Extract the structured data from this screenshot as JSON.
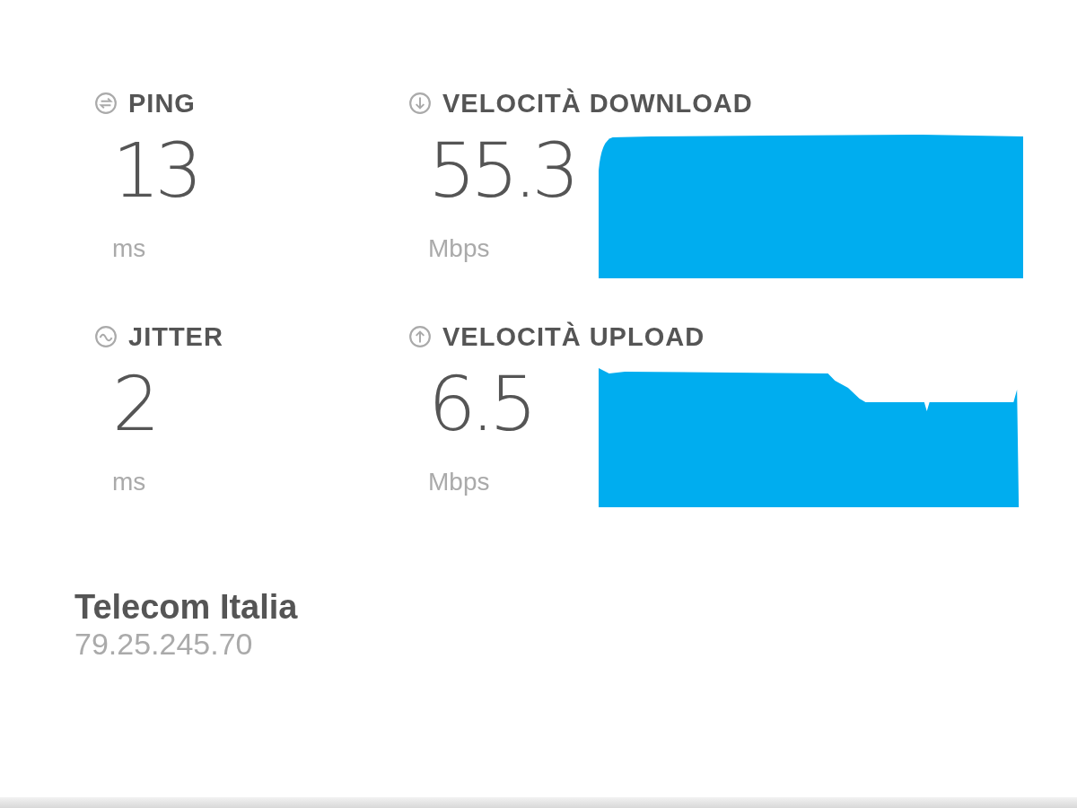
{
  "metrics": [
    {
      "kind": "ping",
      "label": "PING",
      "value": "13",
      "unit": "ms"
    },
    {
      "kind": "download",
      "label": "VELOCITÀ DOWNLOAD",
      "value": "55.3",
      "unit": "Mbps"
    },
    {
      "kind": "jitter",
      "label": "JITTER",
      "value": "2",
      "unit": "ms"
    },
    {
      "kind": "upload",
      "label": "VELOCITÀ UPLOAD",
      "value": "6.5",
      "unit": "Mbps"
    }
  ],
  "provider": {
    "name": "Telecom Italia",
    "ip": "79.25.245.70"
  }
}
